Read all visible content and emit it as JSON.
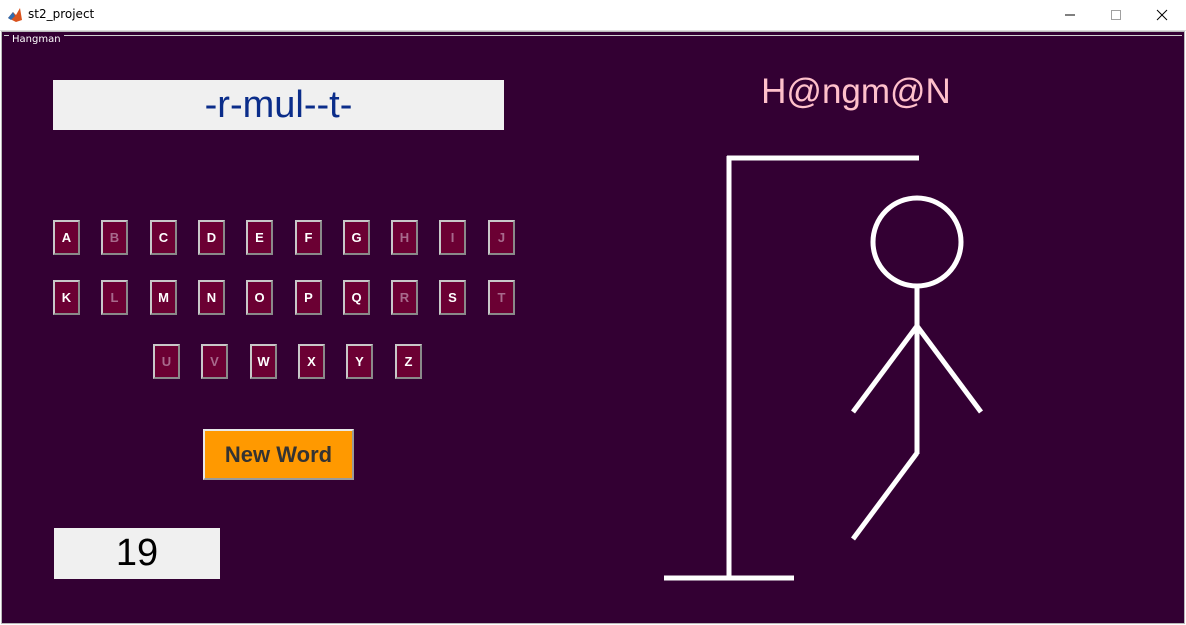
{
  "window": {
    "title": "st2_project",
    "minimize_icon": "minimize-icon",
    "maximize_icon": "maximize-icon",
    "close_icon": "close-icon"
  },
  "panel": {
    "title": "Hangman"
  },
  "game": {
    "masked_word": "-r-mul--t-",
    "title": "H@ngm@N",
    "new_word_label": "New Word",
    "counter": "19",
    "colors": {
      "background": "#330033",
      "letter_button": "#6b0033",
      "new_word_button": "#ff9900",
      "title": "#ffc0cb",
      "word": "#0b2d8a"
    },
    "letters": [
      {
        "label": "A",
        "used": false
      },
      {
        "label": "B",
        "used": true
      },
      {
        "label": "C",
        "used": false
      },
      {
        "label": "D",
        "used": false
      },
      {
        "label": "E",
        "used": false
      },
      {
        "label": "F",
        "used": false
      },
      {
        "label": "G",
        "used": false
      },
      {
        "label": "H",
        "used": true
      },
      {
        "label": "I",
        "used": true
      },
      {
        "label": "J",
        "used": true
      },
      {
        "label": "K",
        "used": false
      },
      {
        "label": "L",
        "used": true
      },
      {
        "label": "M",
        "used": false
      },
      {
        "label": "N",
        "used": false
      },
      {
        "label": "O",
        "used": false
      },
      {
        "label": "P",
        "used": false
      },
      {
        "label": "Q",
        "used": false
      },
      {
        "label": "R",
        "used": true
      },
      {
        "label": "S",
        "used": false
      },
      {
        "label": "T",
        "used": true
      },
      {
        "label": "U",
        "used": true
      },
      {
        "label": "V",
        "used": true
      },
      {
        "label": "W",
        "used": false
      },
      {
        "label": "X",
        "used": false
      },
      {
        "label": "Y",
        "used": false
      },
      {
        "label": "Z",
        "used": false
      }
    ]
  }
}
